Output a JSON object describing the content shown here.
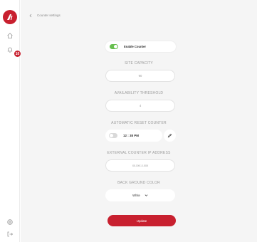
{
  "header": {
    "title": "Counter settings"
  },
  "sidebar": {
    "badge_count": "10"
  },
  "enable_counter": {
    "label": "Enable Counter",
    "enabled": true
  },
  "site_capacity": {
    "label": "SITE CAPACITY",
    "value": "90"
  },
  "availability_threshold": {
    "label": "AVAILABILITY THRESHOLD",
    "value": "4"
  },
  "auto_reset": {
    "label": "AUTOMATIC RESET COUNTER",
    "time": "12 : 38 PM",
    "enabled": false
  },
  "external_ip": {
    "label": "EXTERNAL COUNTER IP ADDRESS",
    "placeholder": "xx.xxx.x.xxx"
  },
  "background_color": {
    "label": "BACK GROUND COLOR",
    "value": "White"
  },
  "update_button": {
    "label": "Update"
  },
  "colors": {
    "brand": "#c8202f",
    "toggle_on": "#67bf4f",
    "toggle_off": "#d9d9d9"
  }
}
